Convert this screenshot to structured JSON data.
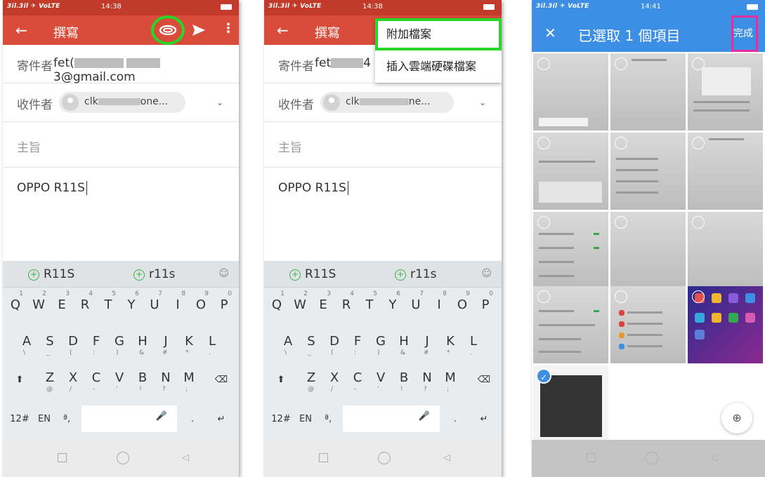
{
  "status": {
    "carrier_left": "1111 1 VoLTE",
    "carrier1": "3il.3il ✈ VoLTE",
    "time1": "14:38",
    "time2": "14:38",
    "time3": "14:41"
  },
  "compose": {
    "back_icon": "←",
    "title": "撰寫",
    "attach_icon": "paperclip-icon",
    "send_icon": "send-icon",
    "more_icon": "⋮",
    "from_label": "寄件者",
    "from_prefix": "fet(",
    "from_suffix": "3@gmail.com",
    "from_prefix2": "fet",
    "from_suffix2": "4",
    "to_label": "收件者",
    "to_prefix": "clk",
    "to_suffix": "one...",
    "to_suffix2": "ne...",
    "subject_placeholder": "主旨",
    "body_text": "OPPO R11S"
  },
  "keyboard": {
    "suggestions": [
      "R11S",
      "r11s"
    ],
    "row1": [
      {
        "k": "Q",
        "s": "1"
      },
      {
        "k": "W",
        "s": "2"
      },
      {
        "k": "E",
        "s": "3"
      },
      {
        "k": "R",
        "s": "4"
      },
      {
        "k": "T",
        "s": "5"
      },
      {
        "k": "Y",
        "s": "6"
      },
      {
        "k": "U",
        "s": "7"
      },
      {
        "k": "I",
        "s": "8"
      },
      {
        "k": "O",
        "s": "9"
      },
      {
        "k": "P",
        "s": "0"
      }
    ],
    "row2": [
      {
        "k": "A",
        "s": "\\"
      },
      {
        "k": "S",
        "s": "_"
      },
      {
        "k": "D",
        "s": "("
      },
      {
        "k": "F",
        "s": ":"
      },
      {
        "k": "G",
        "s": ")"
      },
      {
        "k": "H",
        "s": "&"
      },
      {
        "k": "J",
        "s": "#"
      },
      {
        "k": "K",
        "s": "*"
      },
      {
        "k": "L",
        "s": "."
      }
    ],
    "row3": [
      {
        "k": "Z",
        "s": "@"
      },
      {
        "k": "X",
        "s": "/"
      },
      {
        "k": "C",
        "s": "-"
      },
      {
        "k": "V",
        "s": "'"
      },
      {
        "k": "B",
        "s": "!"
      },
      {
        "k": "N",
        "s": "?"
      },
      {
        "k": "M",
        "s": ";"
      }
    ],
    "shift": "⬆",
    "backspace": "⌫",
    "num_key": "12#",
    "lang_key": "EN",
    "comma_key": "ª,",
    "period_key": ".",
    "enter_key": "↵"
  },
  "menu": {
    "attach_file": "附加檔案",
    "insert_drive": "插入雲端硬碟檔案"
  },
  "picker": {
    "close_icon": "✕",
    "title": "已選取 1 個項目",
    "done": "完成",
    "zoom_icon": "zoom-in-icon"
  },
  "colors": {
    "gmail_red": "#d94c3a",
    "picker_blue": "#3d8fe6",
    "highlight_green": "#27d627",
    "highlight_pink": "#e62d9b"
  }
}
